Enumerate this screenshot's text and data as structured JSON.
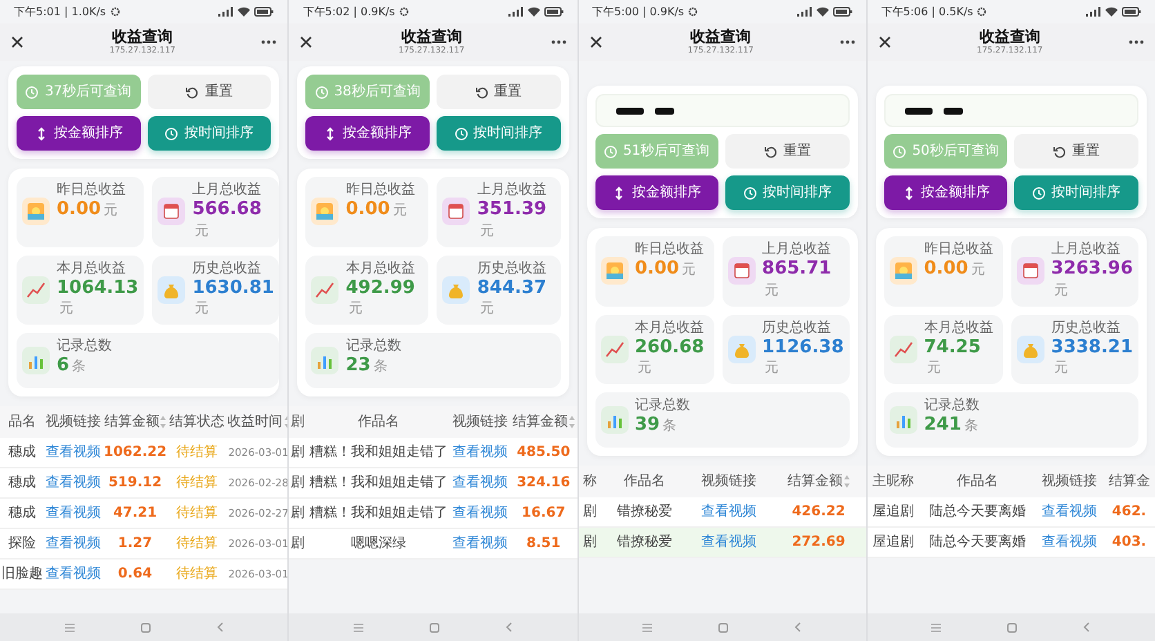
{
  "screens": [
    {
      "status_bar": {
        "time": "下午5:01 | 1.0K/s"
      },
      "header": {
        "title": "收益查询",
        "subtitle": "175.27.132.117"
      },
      "buttons": [
        {
          "label": "37秒后可查询",
          "kind": "countdown",
          "disabled": true
        },
        {
          "label": "重置",
          "kind": "reset",
          "disabled": false
        },
        {
          "label": "按金额排序",
          "kind": "amount",
          "disabled": false
        },
        {
          "label": "按时间排序",
          "kind": "time",
          "disabled": false
        }
      ],
      "stats": [
        {
          "label": "昨日总收益",
          "value": "0.00",
          "unit": "元",
          "kind": "yesterday"
        },
        {
          "label": "上月总收益",
          "value": "566.68",
          "unit": "元",
          "kind": "last_month"
        },
        {
          "label": "本月总收益",
          "value": "1064.13",
          "unit": "元",
          "kind": "this_month"
        },
        {
          "label": "历史总收益",
          "value": "1630.81",
          "unit": "元",
          "kind": "history"
        },
        {
          "label": "记录总数",
          "value": "6",
          "unit": "条",
          "kind": "count"
        }
      ],
      "table": {
        "columns": [
          {
            "label": "品名",
            "kind": "name",
            "sortable": false
          },
          {
            "label": "视频链接",
            "kind": "link",
            "sortable": false
          },
          {
            "label": "结算金额",
            "kind": "amount",
            "sortable": true
          },
          {
            "label": "结算状态",
            "kind": "status",
            "sortable": false
          },
          {
            "label": "收益时间",
            "kind": "time",
            "sortable": true
          }
        ],
        "rows": [
          {
            "selected": false,
            "cells": [
              "穗成",
              "查看视频",
              "1062.22",
              "待结算",
              "2026-03-01"
            ]
          },
          {
            "selected": false,
            "cells": [
              "穗成",
              "查看视频",
              "519.12",
              "待结算",
              "2026-02-28"
            ]
          },
          {
            "selected": false,
            "cells": [
              "穗成",
              "查看视频",
              "47.21",
              "待结算",
              "2026-02-27"
            ]
          },
          {
            "selected": false,
            "cells": [
              "探险",
              "查看视频",
              "1.27",
              "待结算",
              "2026-03-01"
            ]
          },
          {
            "selected": false,
            "cells": [
              "旧脸趣",
              "查看视频",
              "0.64",
              "待结算",
              "2026-03-01"
            ]
          }
        ]
      }
    },
    {
      "status_bar": {
        "time": "下午5:02 | 0.9K/s"
      },
      "header": {
        "title": "收益查询",
        "subtitle": "175.27.132.117"
      },
      "buttons": [
        {
          "label": "38秒后可查询",
          "kind": "countdown",
          "disabled": true
        },
        {
          "label": "重置",
          "kind": "reset",
          "disabled": false
        },
        {
          "label": "按金额排序",
          "kind": "amount",
          "disabled": false
        },
        {
          "label": "按时间排序",
          "kind": "time",
          "disabled": false
        }
      ],
      "stats": [
        {
          "label": "昨日总收益",
          "value": "0.00",
          "unit": "元",
          "kind": "yesterday"
        },
        {
          "label": "上月总收益",
          "value": "351.39",
          "unit": "元",
          "kind": "last_month"
        },
        {
          "label": "本月总收益",
          "value": "492.99",
          "unit": "元",
          "kind": "this_month"
        },
        {
          "label": "历史总收益",
          "value": "844.37",
          "unit": "元",
          "kind": "history"
        },
        {
          "label": "记录总数",
          "value": "23",
          "unit": "条",
          "kind": "count"
        }
      ],
      "table": {
        "columns": [
          {
            "label": "剧",
            "kind": "name",
            "sortable": false
          },
          {
            "label": "作品名",
            "kind": "name",
            "sortable": false
          },
          {
            "label": "视频链接",
            "kind": "link",
            "sortable": false
          },
          {
            "label": "结算金额",
            "kind": "amount",
            "sortable": true
          }
        ],
        "rows": [
          {
            "selected": false,
            "cells": [
              "剧",
              "糟糕！我和姐姐走错了",
              "查看视频",
              "485.50"
            ]
          },
          {
            "selected": false,
            "cells": [
              "剧",
              "糟糕！我和姐姐走错了",
              "查看视频",
              "324.16"
            ]
          },
          {
            "selected": false,
            "cells": [
              "剧",
              "糟糕！我和姐姐走错了",
              "查看视频",
              "16.67"
            ]
          },
          {
            "selected": false,
            "cells": [
              "剧",
              "嗯嗯深绿",
              "查看视频",
              "8.51"
            ]
          }
        ]
      }
    },
    {
      "status_bar": {
        "time": "下午5:00 | 0.9K/s"
      },
      "header": {
        "title": "收益查询",
        "subtitle": "175.27.132.117"
      },
      "query_field": {
        "masked": true
      },
      "buttons": [
        {
          "label": "51秒后可查询",
          "kind": "countdown",
          "disabled": true
        },
        {
          "label": "重置",
          "kind": "reset",
          "disabled": false
        },
        {
          "label": "按金额排序",
          "kind": "amount",
          "disabled": false
        },
        {
          "label": "按时间排序",
          "kind": "time",
          "disabled": false
        }
      ],
      "stats": [
        {
          "label": "昨日总收益",
          "value": "0.00",
          "unit": "元",
          "kind": "yesterday"
        },
        {
          "label": "上月总收益",
          "value": "865.71",
          "unit": "元",
          "kind": "last_month"
        },
        {
          "label": "本月总收益",
          "value": "260.68",
          "unit": "元",
          "kind": "this_month"
        },
        {
          "label": "历史总收益",
          "value": "1126.38",
          "unit": "元",
          "kind": "history"
        },
        {
          "label": "记录总数",
          "value": "39",
          "unit": "条",
          "kind": "count"
        }
      ],
      "table": {
        "columns": [
          {
            "label": "称",
            "kind": "name",
            "sortable": false
          },
          {
            "label": "作品名",
            "kind": "name",
            "sortable": false
          },
          {
            "label": "视频链接",
            "kind": "link",
            "sortable": false
          },
          {
            "label": "结算金额",
            "kind": "amount",
            "sortable": true
          }
        ],
        "rows": [
          {
            "selected": false,
            "cells": [
              "剧",
              "错撩秘爱",
              "查看视频",
              "426.22"
            ]
          },
          {
            "selected": true,
            "cells": [
              "剧",
              "错撩秘爱",
              "查看视频",
              "272.69"
            ]
          }
        ]
      }
    },
    {
      "status_bar": {
        "time": "下午5:06 | 0.5K/s"
      },
      "header": {
        "title": "收益查询",
        "subtitle": "175.27.132.117"
      },
      "query_field": {
        "masked": true
      },
      "buttons": [
        {
          "label": "50秒后可查询",
          "kind": "countdown",
          "disabled": true
        },
        {
          "label": "重置",
          "kind": "reset",
          "disabled": false
        },
        {
          "label": "按金额排序",
          "kind": "amount",
          "disabled": false
        },
        {
          "label": "按时间排序",
          "kind": "time",
          "disabled": false
        }
      ],
      "stats": [
        {
          "label": "昨日总收益",
          "value": "0.00",
          "unit": "元",
          "kind": "yesterday"
        },
        {
          "label": "上月总收益",
          "value": "3263.96",
          "unit": "元",
          "kind": "last_month"
        },
        {
          "label": "本月总收益",
          "value": "74.25",
          "unit": "元",
          "kind": "this_month"
        },
        {
          "label": "历史总收益",
          "value": "3338.21",
          "unit": "元",
          "kind": "history"
        },
        {
          "label": "记录总数",
          "value": "241",
          "unit": "条",
          "kind": "count"
        }
      ],
      "table": {
        "columns": [
          {
            "label": "主昵称",
            "kind": "name",
            "sortable": false
          },
          {
            "label": "作品名",
            "kind": "name",
            "sortable": false
          },
          {
            "label": "视频链接",
            "kind": "link",
            "sortable": false
          },
          {
            "label": "结算金",
            "kind": "amount",
            "sortable": false
          }
        ],
        "rows": [
          {
            "selected": false,
            "cells": [
              "屋追剧",
              "陆总今天要离婚",
              "查看视频",
              "462."
            ]
          },
          {
            "selected": false,
            "cells": [
              "屋追剧",
              "陆总今天要离婚",
              "查看视频",
              "403."
            ]
          }
        ]
      }
    }
  ]
}
